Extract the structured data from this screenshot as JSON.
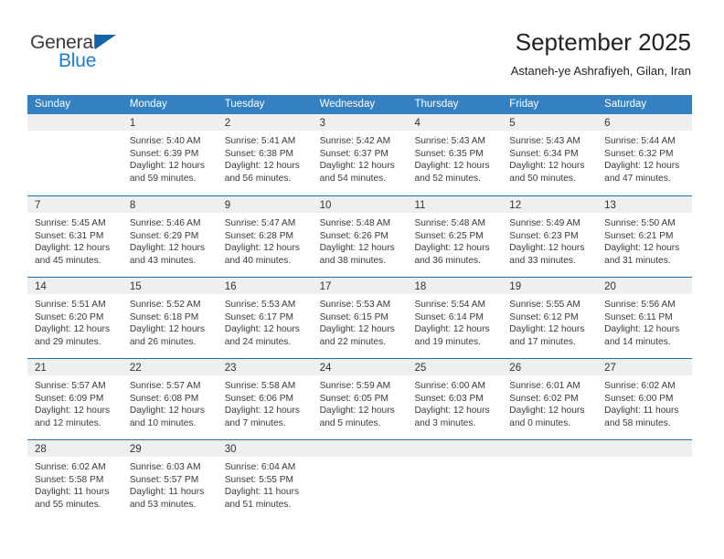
{
  "brand": {
    "name_part1": "General",
    "name_part2": "Blue",
    "triangle_color": "#1463a8",
    "blue_text_color": "#1b7fd4"
  },
  "header": {
    "title": "September 2025",
    "subtitle": "Astaneh-ye Ashrafiyeh, Gilan, Iran"
  },
  "theme": {
    "header_row_bg": "#3580c0",
    "header_row_text": "#ffffff",
    "day_number_band_bg": "#efefef",
    "week_divider": "#1e6fb5",
    "cell_bg": "#ffffff",
    "body_text": "#3a3a3a"
  },
  "weekdays": [
    "Sunday",
    "Monday",
    "Tuesday",
    "Wednesday",
    "Thursday",
    "Friday",
    "Saturday"
  ],
  "weeks": [
    [
      {
        "day": "",
        "lines": []
      },
      {
        "day": "1",
        "lines": [
          "Sunrise: 5:40 AM",
          "Sunset: 6:39 PM",
          "Daylight: 12 hours",
          "and 59 minutes."
        ]
      },
      {
        "day": "2",
        "lines": [
          "Sunrise: 5:41 AM",
          "Sunset: 6:38 PM",
          "Daylight: 12 hours",
          "and 56 minutes."
        ]
      },
      {
        "day": "3",
        "lines": [
          "Sunrise: 5:42 AM",
          "Sunset: 6:37 PM",
          "Daylight: 12 hours",
          "and 54 minutes."
        ]
      },
      {
        "day": "4",
        "lines": [
          "Sunrise: 5:43 AM",
          "Sunset: 6:35 PM",
          "Daylight: 12 hours",
          "and 52 minutes."
        ]
      },
      {
        "day": "5",
        "lines": [
          "Sunrise: 5:43 AM",
          "Sunset: 6:34 PM",
          "Daylight: 12 hours",
          "and 50 minutes."
        ]
      },
      {
        "day": "6",
        "lines": [
          "Sunrise: 5:44 AM",
          "Sunset: 6:32 PM",
          "Daylight: 12 hours",
          "and 47 minutes."
        ]
      }
    ],
    [
      {
        "day": "7",
        "lines": [
          "Sunrise: 5:45 AM",
          "Sunset: 6:31 PM",
          "Daylight: 12 hours",
          "and 45 minutes."
        ]
      },
      {
        "day": "8",
        "lines": [
          "Sunrise: 5:46 AM",
          "Sunset: 6:29 PM",
          "Daylight: 12 hours",
          "and 43 minutes."
        ]
      },
      {
        "day": "9",
        "lines": [
          "Sunrise: 5:47 AM",
          "Sunset: 6:28 PM",
          "Daylight: 12 hours",
          "and 40 minutes."
        ]
      },
      {
        "day": "10",
        "lines": [
          "Sunrise: 5:48 AM",
          "Sunset: 6:26 PM",
          "Daylight: 12 hours",
          "and 38 minutes."
        ]
      },
      {
        "day": "11",
        "lines": [
          "Sunrise: 5:48 AM",
          "Sunset: 6:25 PM",
          "Daylight: 12 hours",
          "and 36 minutes."
        ]
      },
      {
        "day": "12",
        "lines": [
          "Sunrise: 5:49 AM",
          "Sunset: 6:23 PM",
          "Daylight: 12 hours",
          "and 33 minutes."
        ]
      },
      {
        "day": "13",
        "lines": [
          "Sunrise: 5:50 AM",
          "Sunset: 6:21 PM",
          "Daylight: 12 hours",
          "and 31 minutes."
        ]
      }
    ],
    [
      {
        "day": "14",
        "lines": [
          "Sunrise: 5:51 AM",
          "Sunset: 6:20 PM",
          "Daylight: 12 hours",
          "and 29 minutes."
        ]
      },
      {
        "day": "15",
        "lines": [
          "Sunrise: 5:52 AM",
          "Sunset: 6:18 PM",
          "Daylight: 12 hours",
          "and 26 minutes."
        ]
      },
      {
        "day": "16",
        "lines": [
          "Sunrise: 5:53 AM",
          "Sunset: 6:17 PM",
          "Daylight: 12 hours",
          "and 24 minutes."
        ]
      },
      {
        "day": "17",
        "lines": [
          "Sunrise: 5:53 AM",
          "Sunset: 6:15 PM",
          "Daylight: 12 hours",
          "and 22 minutes."
        ]
      },
      {
        "day": "18",
        "lines": [
          "Sunrise: 5:54 AM",
          "Sunset: 6:14 PM",
          "Daylight: 12 hours",
          "and 19 minutes."
        ]
      },
      {
        "day": "19",
        "lines": [
          "Sunrise: 5:55 AM",
          "Sunset: 6:12 PM",
          "Daylight: 12 hours",
          "and 17 minutes."
        ]
      },
      {
        "day": "20",
        "lines": [
          "Sunrise: 5:56 AM",
          "Sunset: 6:11 PM",
          "Daylight: 12 hours",
          "and 14 minutes."
        ]
      }
    ],
    [
      {
        "day": "21",
        "lines": [
          "Sunrise: 5:57 AM",
          "Sunset: 6:09 PM",
          "Daylight: 12 hours",
          "and 12 minutes."
        ]
      },
      {
        "day": "22",
        "lines": [
          "Sunrise: 5:57 AM",
          "Sunset: 6:08 PM",
          "Daylight: 12 hours",
          "and 10 minutes."
        ]
      },
      {
        "day": "23",
        "lines": [
          "Sunrise: 5:58 AM",
          "Sunset: 6:06 PM",
          "Daylight: 12 hours",
          "and 7 minutes."
        ]
      },
      {
        "day": "24",
        "lines": [
          "Sunrise: 5:59 AM",
          "Sunset: 6:05 PM",
          "Daylight: 12 hours",
          "and 5 minutes."
        ]
      },
      {
        "day": "25",
        "lines": [
          "Sunrise: 6:00 AM",
          "Sunset: 6:03 PM",
          "Daylight: 12 hours",
          "and 3 minutes."
        ]
      },
      {
        "day": "26",
        "lines": [
          "Sunrise: 6:01 AM",
          "Sunset: 6:02 PM",
          "Daylight: 12 hours",
          "and 0 minutes."
        ]
      },
      {
        "day": "27",
        "lines": [
          "Sunrise: 6:02 AM",
          "Sunset: 6:00 PM",
          "Daylight: 11 hours",
          "and 58 minutes."
        ]
      }
    ],
    [
      {
        "day": "28",
        "lines": [
          "Sunrise: 6:02 AM",
          "Sunset: 5:58 PM",
          "Daylight: 11 hours",
          "and 55 minutes."
        ]
      },
      {
        "day": "29",
        "lines": [
          "Sunrise: 6:03 AM",
          "Sunset: 5:57 PM",
          "Daylight: 11 hours",
          "and 53 minutes."
        ]
      },
      {
        "day": "30",
        "lines": [
          "Sunrise: 6:04 AM",
          "Sunset: 5:55 PM",
          "Daylight: 11 hours",
          "and 51 minutes."
        ]
      },
      {
        "day": "",
        "lines": []
      },
      {
        "day": "",
        "lines": []
      },
      {
        "day": "",
        "lines": []
      },
      {
        "day": "",
        "lines": []
      }
    ]
  ]
}
